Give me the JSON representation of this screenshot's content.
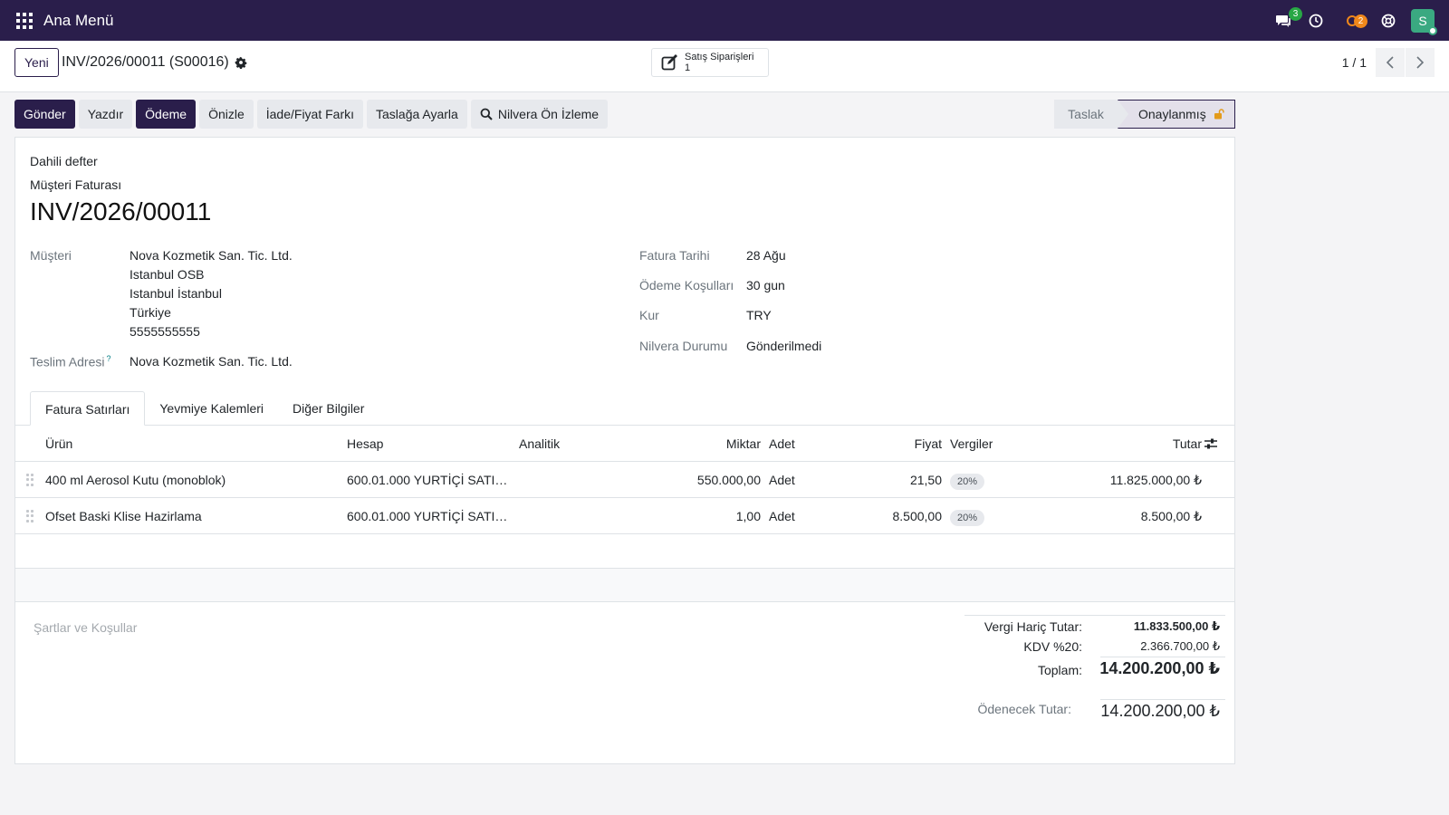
{
  "navbar": {
    "brand": "Ana Menü",
    "messages_count": "3",
    "activities_count": "2",
    "avatar_letter": "S"
  },
  "control": {
    "new_label": "Yeni",
    "record_title": "INV/2026/00011 (S00016)",
    "smart_button_label": "Satış Siparişleri",
    "smart_button_count": "1",
    "pager_value": "1 / 1"
  },
  "actions": {
    "send": "Gönder",
    "print": "Yazdır",
    "payment": "Ödeme",
    "preview": "Önizle",
    "refund": "İade/Fiyat Farkı",
    "reset_draft": "Taslağa Ayarla",
    "nilvera_preview": "Nilvera Ön İzleme"
  },
  "status": {
    "draft": "Taslak",
    "posted": "Onaylanmış"
  },
  "sheet": {
    "journal": "Dahili defter",
    "move_type": "Müşteri Faturası",
    "name": "INV/2026/00011",
    "customer_label": "Müşteri",
    "customer_lines": [
      "Nova Kozmetik San. Tic. Ltd.",
      "Istanbul OSB",
      "Istanbul İstanbul",
      "Türkiye",
      "5555555555"
    ],
    "delivery_label": "Teslim Adresi",
    "delivery_help": "?",
    "delivery_value": "Nova Kozmetik San. Tic. Ltd.",
    "invoice_date_label": "Fatura Tarihi",
    "invoice_date": "28 Ağu",
    "payment_terms_label": "Ödeme Koşulları",
    "payment_terms": "30 gun",
    "currency_label": "Kur",
    "currency": "TRY",
    "nilvera_status_label": "Nilvera Durumu",
    "nilvera_status": "Gönderilmedi"
  },
  "tabs": [
    "Fatura Satırları",
    "Yevmiye Kalemleri",
    "Diğer Bilgiler"
  ],
  "table": {
    "headers": {
      "product": "Ürün",
      "account": "Hesap",
      "analytic": "Analitik",
      "quantity": "Miktar",
      "uom": "Adet",
      "price": "Fiyat",
      "taxes": "Vergiler",
      "subtotal": "Tutar"
    },
    "rows": [
      {
        "product": "400 ml Aerosol Kutu (monoblok)",
        "account": "600.01.000 YURTİÇİ SATI…",
        "quantity": "550.000,00",
        "uom": "Adet",
        "price": "21,50",
        "tax": "20%",
        "subtotal": "11.825.000,00 ₺"
      },
      {
        "product": "Ofset Baski Klise Hazirlama",
        "account": "600.01.000 YURTİÇİ SATI…",
        "quantity": "1,00",
        "uom": "Adet",
        "price": "8.500,00",
        "tax": "20%",
        "subtotal": "8.500,00 ₺"
      }
    ]
  },
  "terms_placeholder": "Şartlar ve Koşullar",
  "totals": {
    "untaxed_label": "Vergi Hariç Tutar:",
    "untaxed_value": "11.833.500,00 ₺",
    "tax_label": "KDV %20:",
    "tax_value": "2.366.700,00 ₺",
    "total_label": "Toplam:",
    "total_value": "14.200.200,00 ₺",
    "due_label": "Ödenecek Tutar:",
    "due_value": "14.200.200,00 ₺"
  }
}
